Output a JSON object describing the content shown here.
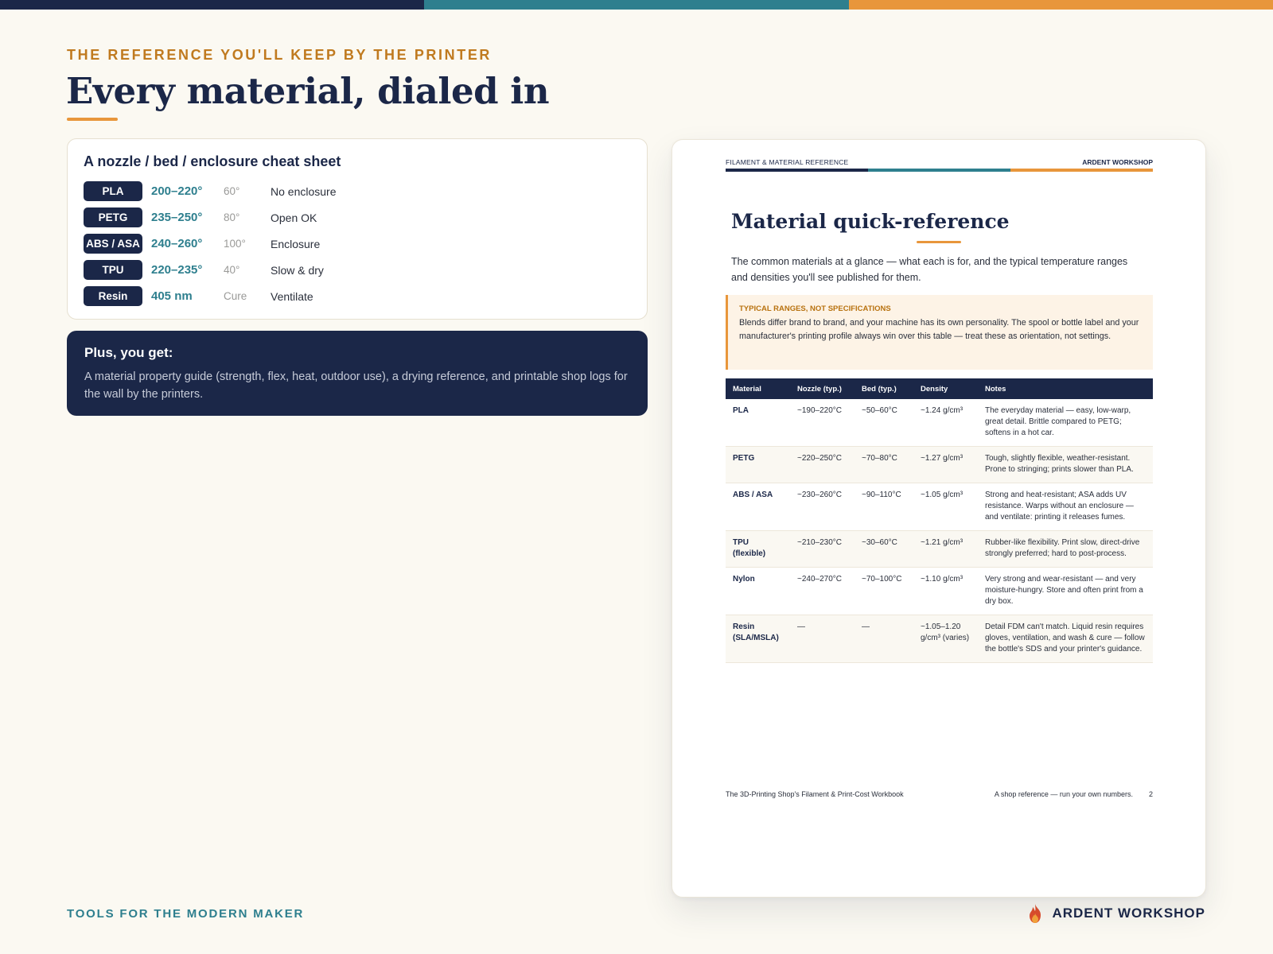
{
  "colors": {
    "navy": "#1b2748",
    "teal": "#2e7f8e",
    "orange": "#e8963b",
    "eyebrow": "#c07a1f"
  },
  "eyebrow": "THE REFERENCE YOU'LL KEEP BY THE PRINTER",
  "headline": "Every material, dialed in",
  "cheat_sheet": {
    "title": "A nozzle / bed / enclosure cheat sheet",
    "rows": [
      {
        "material": "PLA",
        "nozzle": "200–220°",
        "bed": "60°",
        "note": "No enclosure"
      },
      {
        "material": "PETG",
        "nozzle": "235–250°",
        "bed": "80°",
        "note": "Open OK"
      },
      {
        "material": "ABS / ASA",
        "nozzle": "240–260°",
        "bed": "100°",
        "note": "Enclosure"
      },
      {
        "material": "TPU",
        "nozzle": "220–235°",
        "bed": "40°",
        "note": "Slow & dry"
      },
      {
        "material": "Resin",
        "nozzle": "405 nm",
        "bed": "Cure",
        "note": "Ventilate"
      }
    ]
  },
  "plus": {
    "title": "Plus, you get:",
    "text": "A material property guide (strength, flex, heat, outdoor use), a drying reference, and printable shop logs for the wall by the printers."
  },
  "document": {
    "header_left": "FILAMENT & MATERIAL REFERENCE",
    "header_right": "ARDENT WORKSHOP",
    "title": "Material quick-reference",
    "intro": "The common materials at a glance — what each is for, and the typical temperature ranges and densities you'll see published for them.",
    "callout_title": "TYPICAL RANGES, NOT SPECIFICATIONS",
    "callout_text": "Blends differ brand to brand, and your machine has its own personality. The spool or bottle label and your manufacturer's printing profile always win over this table — treat these as orientation, not settings.",
    "table": {
      "headers": [
        "Material",
        "Nozzle (typ.)",
        "Bed (typ.)",
        "Density",
        "Notes"
      ],
      "rows": [
        [
          "PLA",
          "~190–220°C",
          "~50–60°C",
          "~1.24 g/cm³",
          "The everyday material — easy, low-warp, great detail. Brittle compared to PETG; softens in a hot car."
        ],
        [
          "PETG",
          "~220–250°C",
          "~70–80°C",
          "~1.27 g/cm³",
          "Tough, slightly flexible, weather-resistant. Prone to stringing; prints slower than PLA."
        ],
        [
          "ABS / ASA",
          "~230–260°C",
          "~90–110°C",
          "~1.05 g/cm³",
          "Strong and heat-resistant; ASA adds UV resistance. Warps without an enclosure — and ventilate: printing it releases fumes."
        ],
        [
          "TPU (flexible)",
          "~210–230°C",
          "~30–60°C",
          "~1.21 g/cm³",
          "Rubber-like flexibility. Print slow, direct-drive strongly preferred; hard to post-process."
        ],
        [
          "Nylon",
          "~240–270°C",
          "~70–100°C",
          "~1.10 g/cm³",
          "Very strong and wear-resistant — and very moisture-hungry. Store and often print from a dry box."
        ],
        [
          "Resin (SLA/MSLA)",
          "—",
          "—",
          "~1.05–1.20 g/cm³ (varies)",
          "Detail FDM can't match. Liquid resin requires gloves, ventilation, and wash & cure — follow the bottle's SDS and your printer's guidance."
        ]
      ]
    },
    "footer_left": "The 3D-Printing Shop's Filament & Print-Cost Workbook",
    "footer_right": "A shop reference — run your own numbers.",
    "page_number": "2"
  },
  "footer_tagline": "TOOLS FOR THE MODERN MAKER",
  "brand": {
    "name": "ARDENT WORKSHOP",
    "icon": "flame-icon"
  }
}
